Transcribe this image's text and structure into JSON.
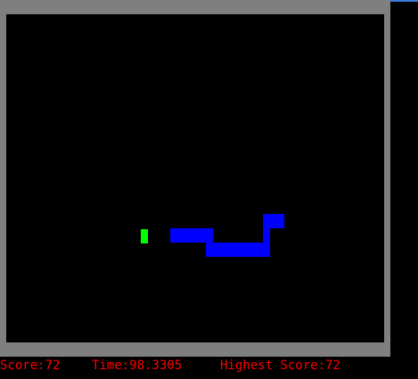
{
  "colors": {
    "frame": "#7f7f7f",
    "field": "#000000",
    "snake": "#0000ff",
    "food": "#00ff00",
    "hud_text": "#ff0000"
  },
  "hud": {
    "score_text": "Score:72",
    "time_text": "Time:98.3305",
    "highest_text": "Highest Score:72"
  }
}
